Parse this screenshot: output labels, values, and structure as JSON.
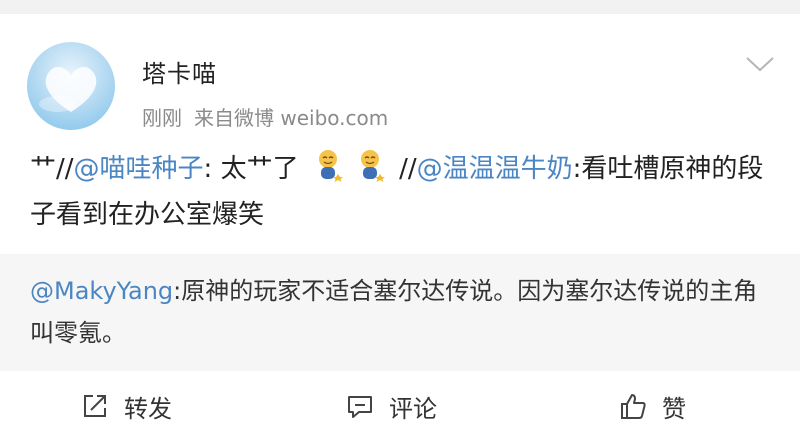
{
  "post": {
    "username": "塔卡喵",
    "time": "刚刚",
    "source": "来自微博 weibo.com",
    "body": {
      "seg1": "艹//",
      "mention1": "@喵哇种子",
      "seg2": ": 太艹了 ",
      "seg3": " //",
      "mention2": "@温温温牛奶",
      "seg4": ":看吐槽原神的段子看到在办公室爆笑"
    },
    "emoji_name": "cry-laugh-emoji"
  },
  "repost": {
    "mention": "@MakyYang",
    "text": ":原神的玩家不适合塞尔达传说。因为塞尔达传说的主角叫零氪。"
  },
  "actions": {
    "repost_label": "转发",
    "comment_label": "评论",
    "like_label": "赞"
  },
  "colors": {
    "link": "#4b86c4",
    "meta": "#8a8a8a",
    "repost_bg": "#f6f6f6",
    "page_bg": "#f2f2f2"
  }
}
